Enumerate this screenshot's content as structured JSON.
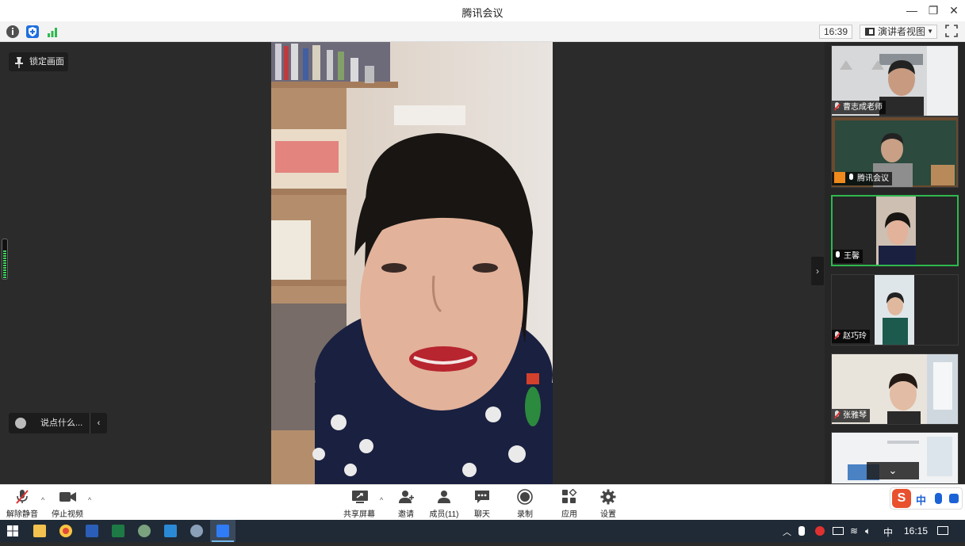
{
  "window": {
    "title": "腾讯会议",
    "minimize_icon": "—",
    "restore_icon": "❐",
    "close_icon": "✕"
  },
  "infobar": {
    "time": "16:39",
    "view_label": "演讲者视图",
    "view_caret": "▼"
  },
  "stage": {
    "lock_label": "锁定画面",
    "chat_placeholder": "说点什么...",
    "chat_collapse": "‹",
    "speaker_volume_level": 0.7
  },
  "panel": {
    "collapse_icon": "›",
    "scroll_icon": "⌄",
    "participants": [
      {
        "name": "曹志成老师",
        "muted": true,
        "host": false,
        "active": false
      },
      {
        "name": "腾讯会议",
        "muted": false,
        "host": true,
        "active": false
      },
      {
        "name": "王馨",
        "muted": false,
        "host": false,
        "active": true
      },
      {
        "name": "赵巧玲",
        "muted": true,
        "host": false,
        "active": false
      },
      {
        "name": "张雅琴",
        "muted": true,
        "host": false,
        "active": false
      }
    ]
  },
  "toolbar": {
    "unmute": "解除静音",
    "stop_video": "停止视频",
    "share": "共享屏幕",
    "invite": "邀请",
    "members": "成员(11)",
    "chat": "聊天",
    "record": "录制",
    "apps": "应用",
    "settings": "设置",
    "caret": "^"
  },
  "ime": {
    "logo": "S",
    "mode": "中"
  },
  "taskbar": {
    "time": "16:15",
    "ime_mode": "中"
  }
}
